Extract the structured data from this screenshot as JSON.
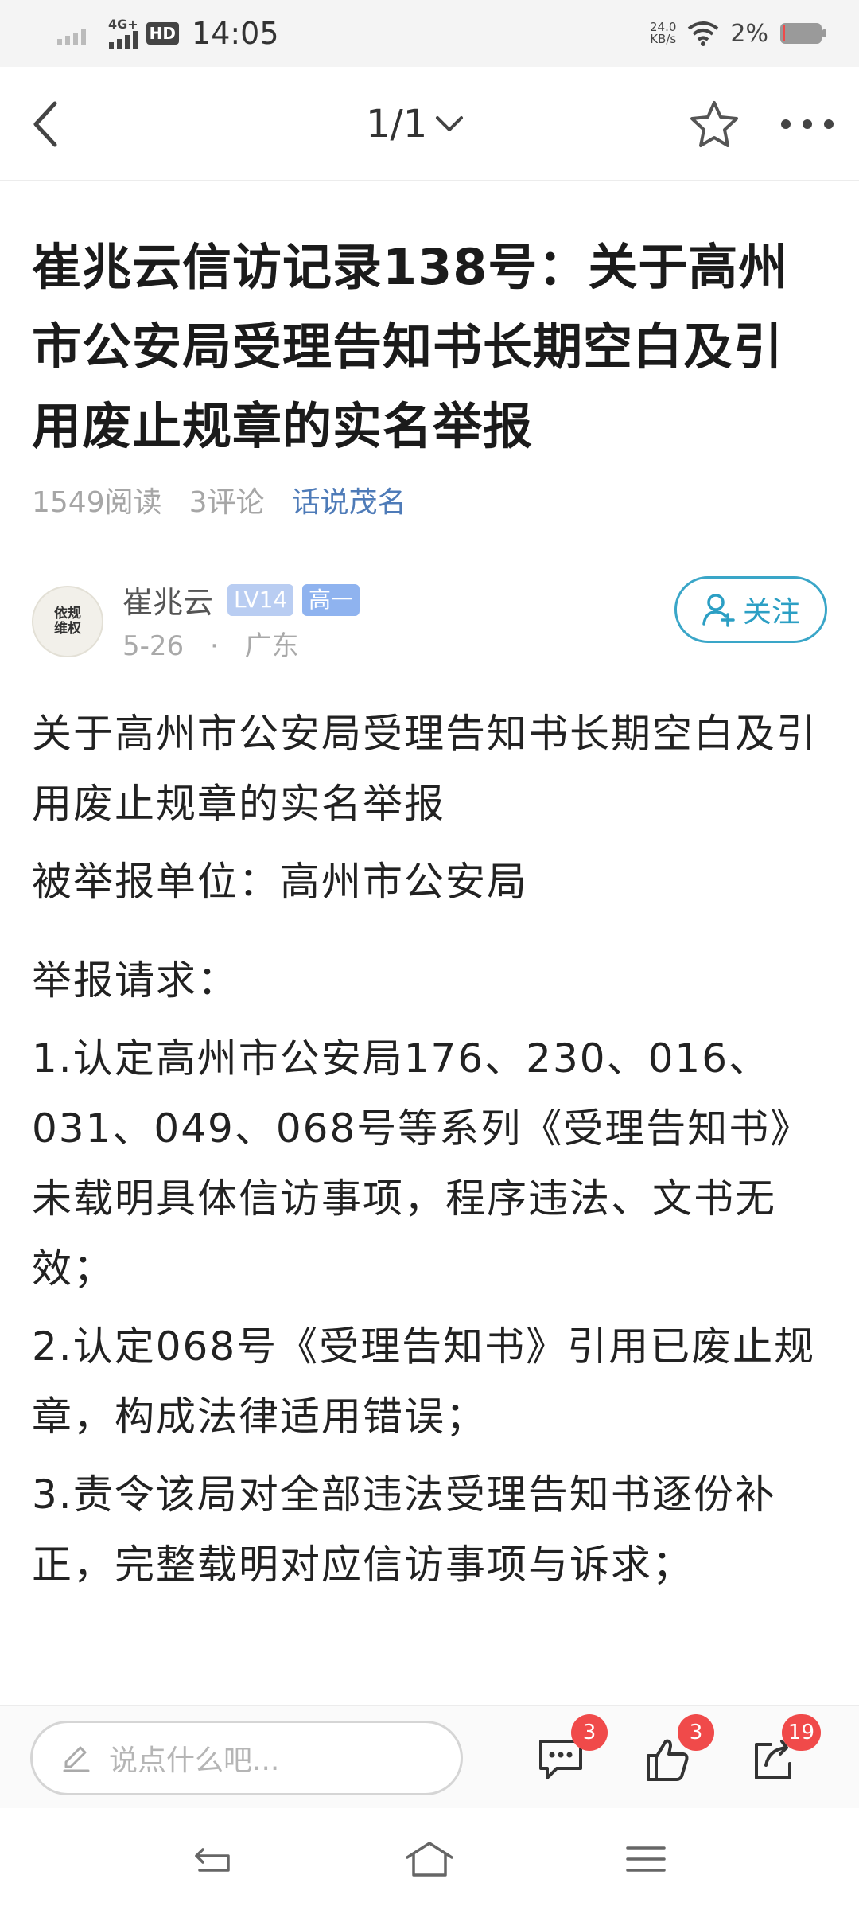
{
  "status_bar": {
    "time": "14:05",
    "network": "4G+",
    "hd": "HD",
    "net_speed_value": "24.0",
    "net_speed_unit": "KB/s",
    "battery": "2%"
  },
  "nav": {
    "page_indicator": "1/1"
  },
  "article": {
    "title": "崔兆云信访记录138号：关于高州市公安局受理告知书长期空白及引用废止规章的实名举报",
    "reads": "1549阅读",
    "comments": "3评论",
    "topic": "话说茂名",
    "author": {
      "avatar_text": "依规维权",
      "name": "崔兆云",
      "level": "LV14",
      "grade": "高一",
      "date": "5-26",
      "separator": "·",
      "location": "广东",
      "follow_label": "关注"
    },
    "paragraphs": [
      "关于高州市公安局受理告知书长期空白及引用废止规章的实名举报",
      "被举报单位：高州市公安局",
      "举报请求：",
      "1.认定高州市公安局176、230、016、031、049、068号等系列《受理告知书》未载明具体信访事项，程序违法、文书无效；",
      "2.认定068号《受理告知书》引用已废止规章，构成法律适用错误；",
      "3.责令该局对全部违法受理告知书逐份补正，完整载明对应信访事项与诉求；"
    ]
  },
  "action_bar": {
    "comment_placeholder": "说点什么吧...",
    "comment_count": "3",
    "like_count": "3",
    "share_count": "19"
  },
  "colors": {
    "accent_blue": "#2c9fc4",
    "topic_blue": "#4e7bb8",
    "badge_red": "#f04a4a"
  },
  "icons": [
    "back-arrow-icon",
    "chevron-down-icon",
    "star-icon",
    "more-dots-icon",
    "add-user-icon",
    "pencil-icon",
    "comment-icon",
    "thumbs-up-icon",
    "share-icon",
    "system-back-icon",
    "system-home-icon",
    "system-menu-icon"
  ]
}
